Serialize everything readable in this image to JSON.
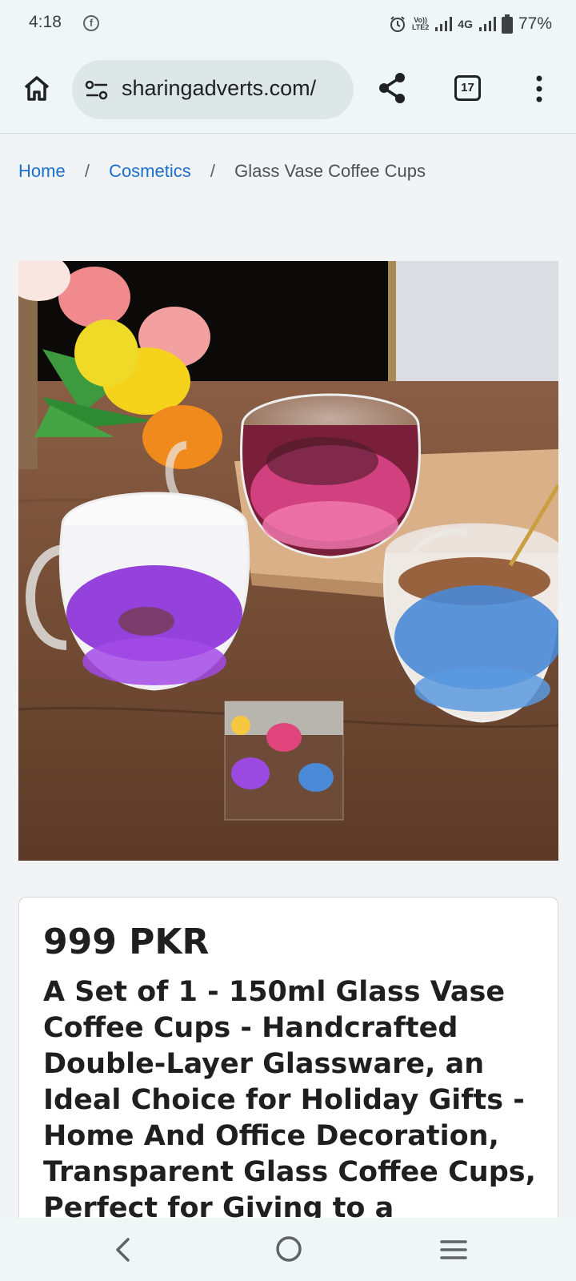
{
  "status_bar": {
    "time": "4:18",
    "volte_top": "Vo))",
    "volte_bottom": "LTE2",
    "network": "4G",
    "battery": "77%"
  },
  "toolbar": {
    "url": "sharingadverts.com/",
    "tab_count": "17",
    "icons": [
      "home-icon",
      "site-settings-icon",
      "share-icon",
      "tabs-icon",
      "more-menu-icon"
    ]
  },
  "breadcrumb": {
    "items": [
      "Home",
      "Cosmetics"
    ],
    "separator": "/",
    "current": "Glass Vase Coffee Cups"
  },
  "product": {
    "price": "999 PKR",
    "title": "A Set of 1 - 150ml Glass Vase Coffee Cups - Handcrafted Double-Layer Glassware, an Ideal Choice for Holiday Gifts - Home And Office Decoration, Transparent Glass Coffee Cups, Perfect for Giving to a"
  },
  "nav_bar": {
    "icons": [
      "back-icon",
      "home-circle-icon",
      "recents-menu-icon"
    ]
  },
  "colors": {
    "chrome_bg": "#eef7f6",
    "url_pill": "#dde7e6",
    "link": "#1a6fd1",
    "page_bg": "#f1f3f4"
  }
}
